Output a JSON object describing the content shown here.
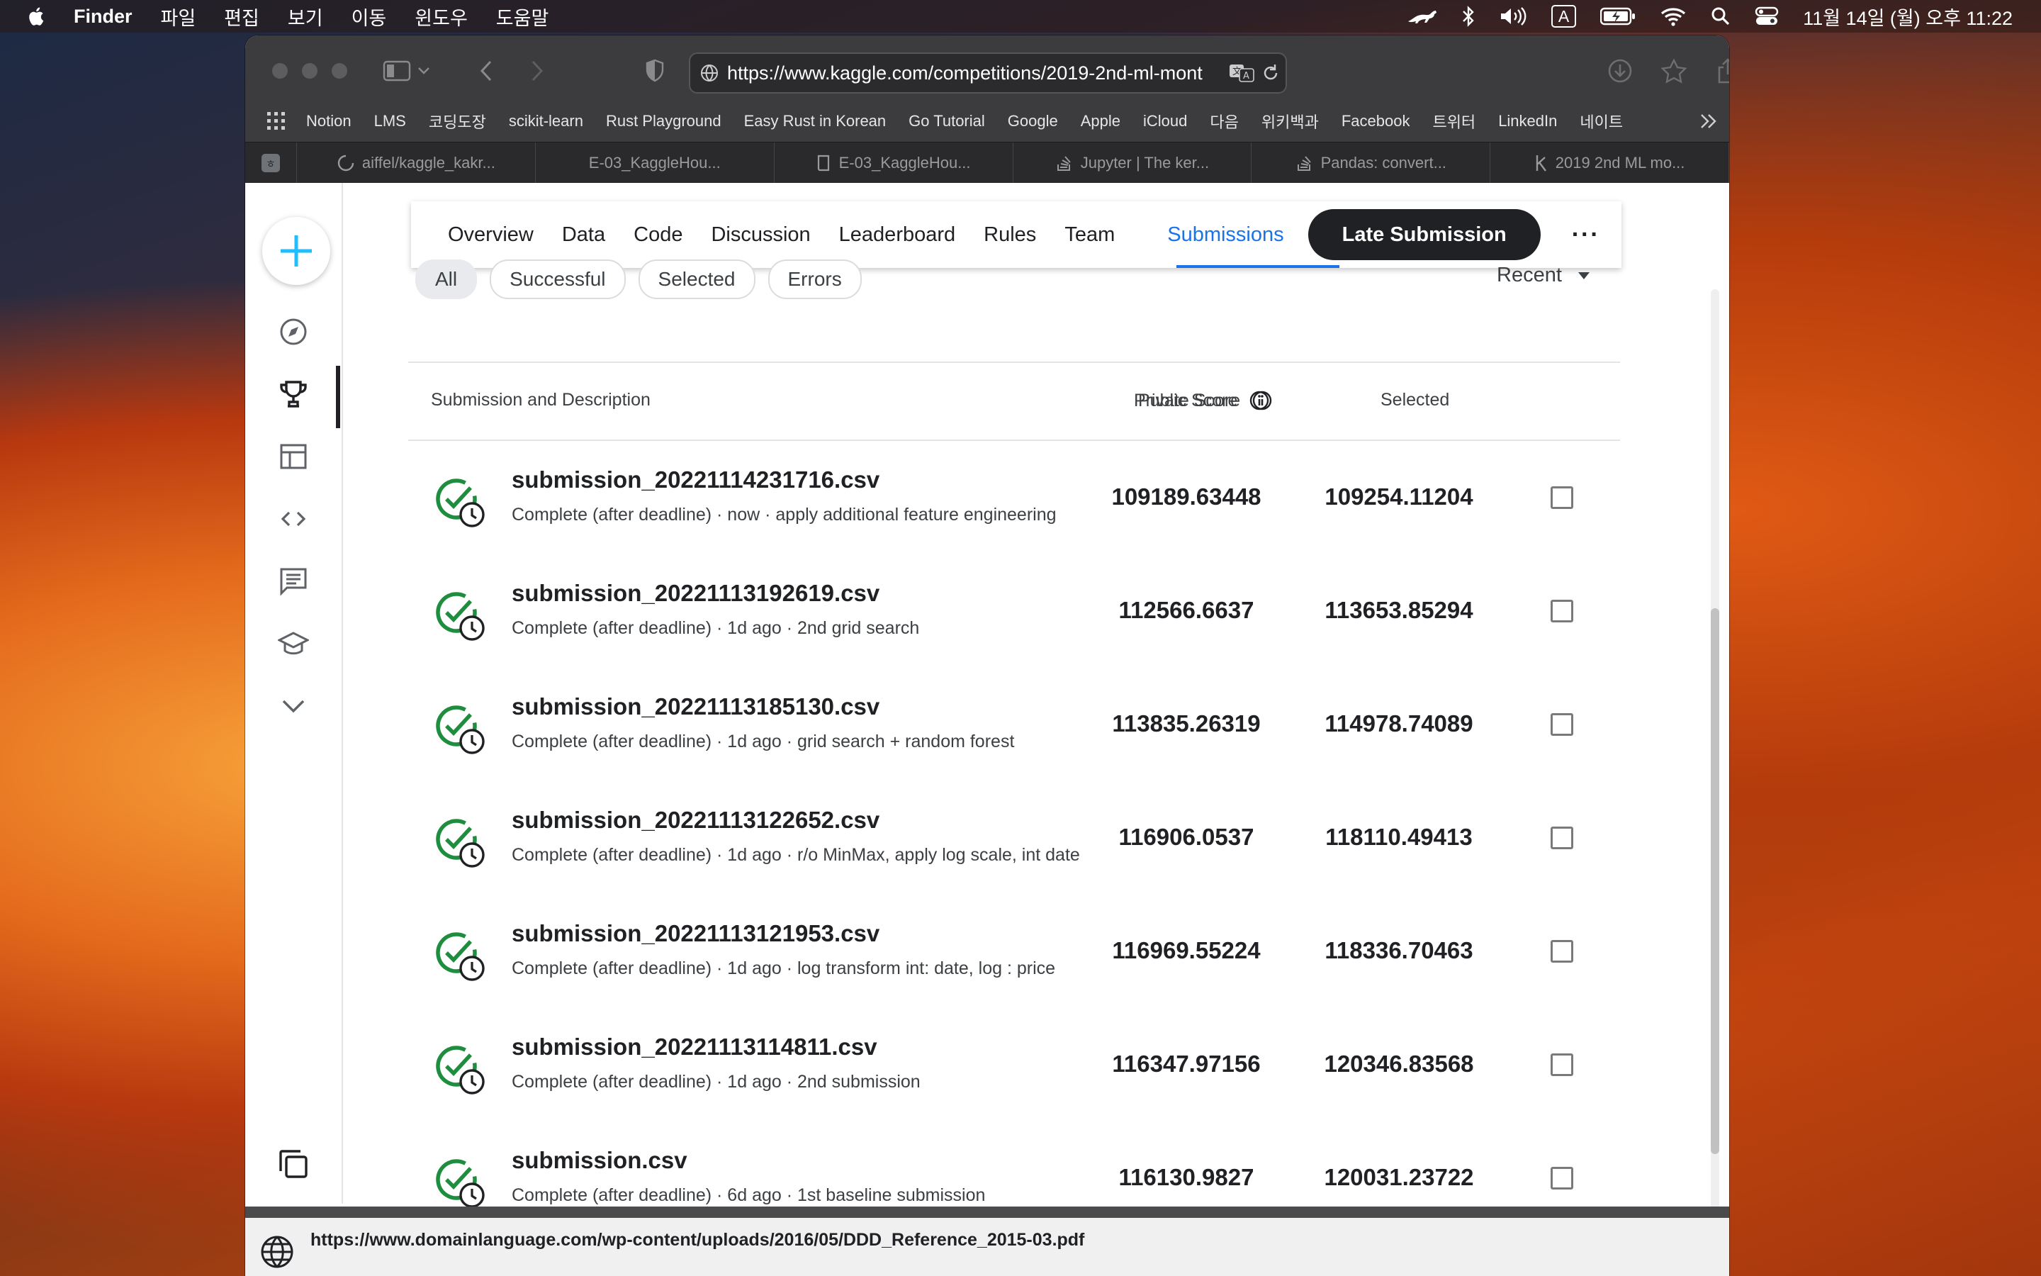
{
  "menubar": {
    "app": "Finder",
    "items": [
      "파일",
      "편집",
      "보기",
      "이동",
      "윈도우",
      "도움말"
    ],
    "input_source": "A",
    "clock": "11월 14일 (월) 오후 11:22"
  },
  "browser": {
    "url": "https://www.kaggle.com/competitions/2019-2nd-ml-mont",
    "bookmarks": [
      "Notion",
      "LMS",
      "코딩도장",
      "scikit-learn",
      "Rust Playground",
      "Easy Rust in Korean",
      "Go Tutorial",
      "Google",
      "Apple",
      "iCloud",
      "다음",
      "위키백과",
      "Facebook",
      "트위터",
      "LinkedIn",
      "네이트"
    ],
    "tabs": [
      "aiffel/kaggle_kakr...",
      "E-03_KaggleHou...",
      "E-03_KaggleHou...",
      "Jupyter | The ker...",
      "Pandas: convert...",
      "2019 2nd ML mo..."
    ],
    "status_link": "https://www.domainlanguage.com/wp-content/uploads/2016/05/DDD_Reference_2015-03.pdf"
  },
  "nav": {
    "items": [
      "Overview",
      "Data",
      "Code",
      "Discussion",
      "Leaderboard",
      "Rules",
      "Team",
      "Submissions"
    ],
    "active": "Submissions",
    "late_submission_label": "Late Submission",
    "more_label": "···"
  },
  "filters": {
    "chips": [
      "All",
      "Successful",
      "Selected",
      "Errors"
    ],
    "selected": "All",
    "sort": "Recent"
  },
  "table": {
    "headers": {
      "submission": "Submission and Description",
      "private": "Private Score",
      "public": "Public Score",
      "selected": "Selected"
    },
    "rows": [
      {
        "file": "submission_20221114231716.csv",
        "desc": "Complete (after deadline) · now · apply additional feature engineering",
        "private": "109189.63448",
        "public": "109254.11204"
      },
      {
        "file": "submission_20221113192619.csv",
        "desc": "Complete (after deadline) · 1d ago · 2nd grid search",
        "private": "112566.6637",
        "public": "113653.85294"
      },
      {
        "file": "submission_20221113185130.csv",
        "desc": "Complete (after deadline) · 1d ago · grid search + random forest",
        "private": "113835.26319",
        "public": "114978.74089"
      },
      {
        "file": "submission_20221113122652.csv",
        "desc": "Complete (after deadline) · 1d ago · r/o MinMax, apply log scale, int date",
        "private": "116906.0537",
        "public": "118110.49413"
      },
      {
        "file": "submission_20221113121953.csv",
        "desc": "Complete (after deadline) · 1d ago · log transform int: date, log : price",
        "private": "116969.55224",
        "public": "118336.70463"
      },
      {
        "file": "submission_20221113114811.csv",
        "desc": "Complete (after deadline) · 1d ago · 2nd submission",
        "private": "116347.97156",
        "public": "120346.83568"
      },
      {
        "file": "submission.csv",
        "desc": "Complete (after deadline) · 6d ago · 1st baseline submission",
        "private": "116130.9827",
        "public": "120031.23722"
      }
    ]
  },
  "colors": {
    "accent": "#1a73e8",
    "success": "#1e8e3e",
    "dark_button": "#202124"
  }
}
